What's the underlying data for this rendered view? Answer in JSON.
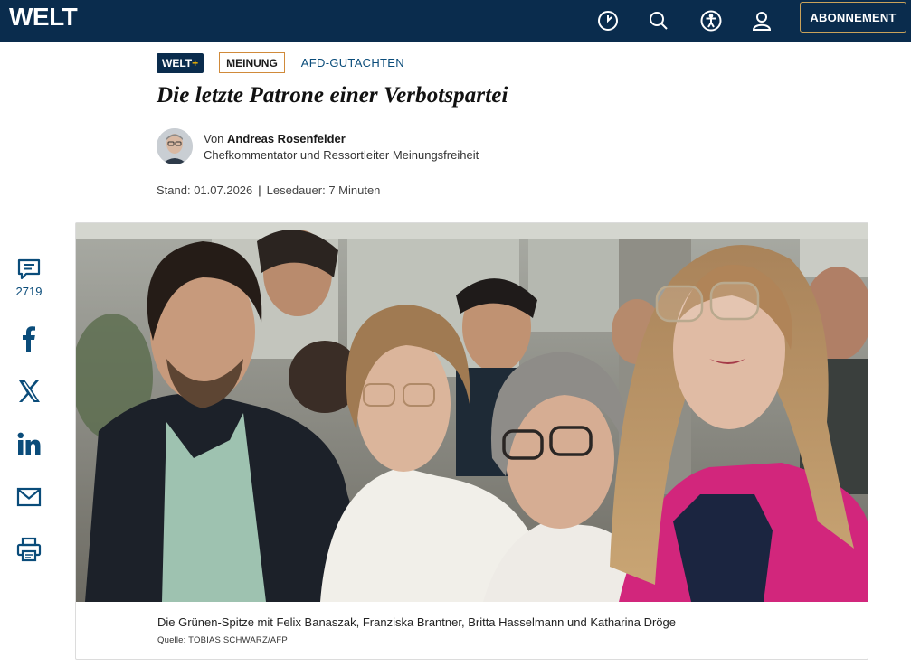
{
  "header": {
    "logo": "WELT",
    "subscribe_label": "ABONNEMENT",
    "icons": [
      "check-circle-icon",
      "search-icon",
      "accessibility-icon",
      "user-icon"
    ]
  },
  "article": {
    "tag_brand": "WELT",
    "tag_brand_plus": "+",
    "tag_category": "MEINUNG",
    "topic": "AFD-GUTACHTEN",
    "headline": "Die letzte Patrone einer Verbotspartei",
    "author_prefix": "Von",
    "author_name": "Andreas Rosenfelder",
    "author_role": "Chefkommentator und Ressortleiter Meinungsfreiheit",
    "stand_label": "Stand: 01.07.2026",
    "separator": "|",
    "reading_time": "Lesedauer: 7 Minuten"
  },
  "share": {
    "comment_count": "2719",
    "icons": [
      "comment-icon",
      "facebook-icon",
      "x-icon",
      "linkedin-icon",
      "mail-icon",
      "print-icon"
    ]
  },
  "figure": {
    "caption": "Die Grünen-Spitze mit Felix Banaszak, Franziska Brantner, Britta Hasselmann und Katharina Dröge",
    "credit": "Quelle: TOBIAS SCHWARZ/AFP"
  },
  "colors": {
    "navy": "#0a2c4d",
    "accent_gold": "#c9a25a",
    "meinung_border": "#d08a3a",
    "link_blue": "#0a4c7a"
  }
}
